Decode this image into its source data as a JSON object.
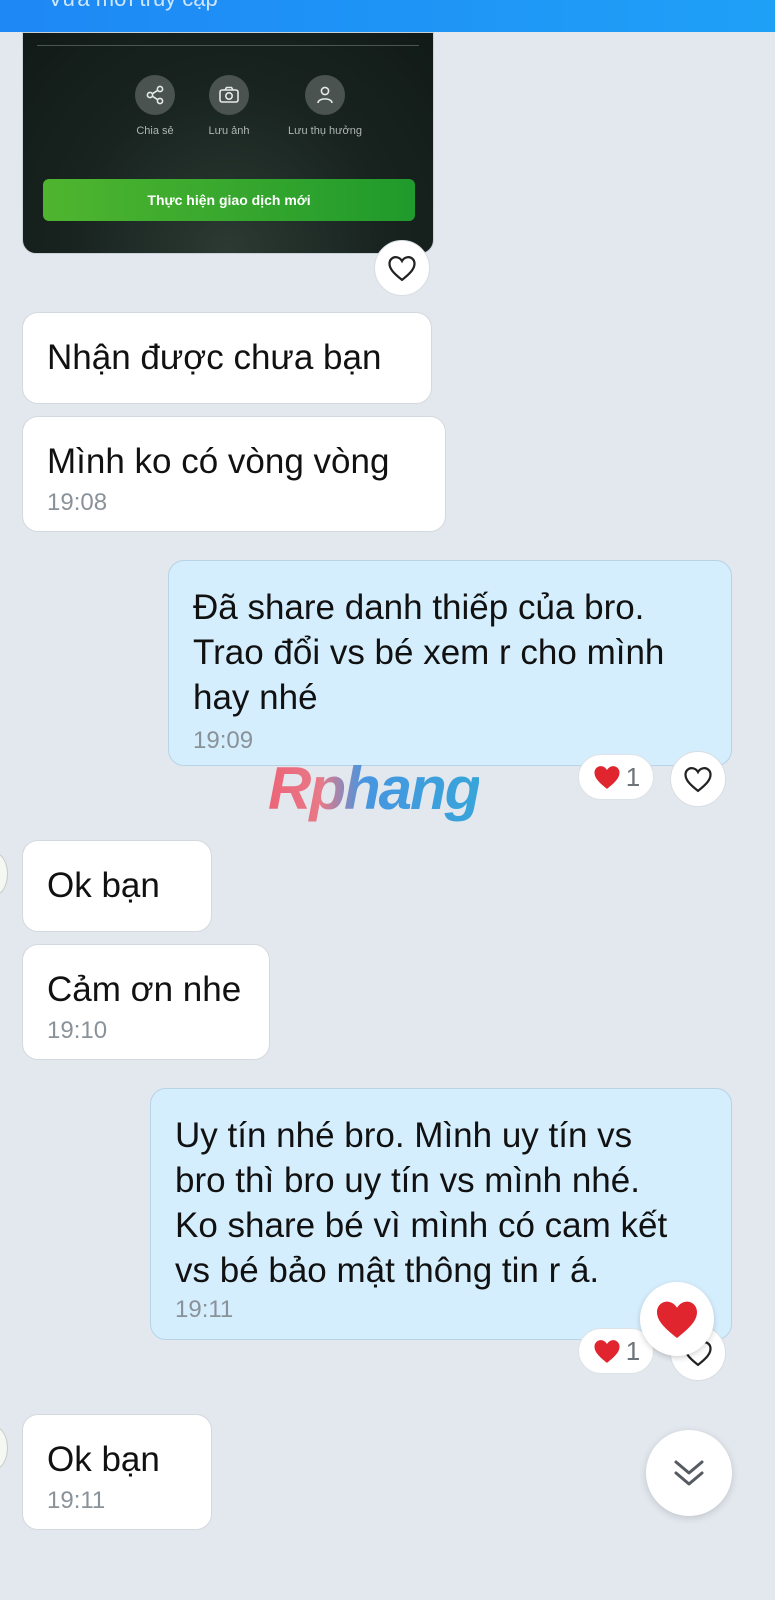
{
  "status_bar": {
    "text": "Vừa mới truy cập"
  },
  "image_card": {
    "actions": [
      {
        "label": "Chia sẻ",
        "icon": "share-icon"
      },
      {
        "label": "Lưu ảnh",
        "icon": "camera-icon"
      },
      {
        "label": "Lưu thụ hưởng",
        "icon": "person-icon"
      }
    ],
    "new_transaction_label": "Thực hiện giao dịch mới"
  },
  "messages": [
    {
      "id": "m1",
      "direction": "incoming",
      "text": "Nhận được chưa bạn",
      "time": ""
    },
    {
      "id": "m2",
      "direction": "incoming",
      "text": "Mình ko có vòng vòng",
      "time": "19:08"
    },
    {
      "id": "m3",
      "direction": "outgoing",
      "text": "Đã share danh thiếp của bro.\nTrao đổi vs bé xem r cho mình\nhay nhé",
      "time": "19:09",
      "reaction_count": "1"
    },
    {
      "id": "m4",
      "direction": "incoming",
      "text": "Ok bạn",
      "time": ""
    },
    {
      "id": "m5",
      "direction": "incoming",
      "text": "Cảm ơn nhe",
      "time": "19:10"
    },
    {
      "id": "m6",
      "direction": "outgoing",
      "text": "Uy tín nhé bro. Mình uy tín vs\nbro thì bro uy tín vs mình nhé.\nKo share bé vì mình có cam kết\nvs bé bảo mật thông tin r á.",
      "time": "19:11",
      "reaction_count": "1"
    },
    {
      "id": "m7",
      "direction": "incoming",
      "text": "Ok bạn",
      "time": "19:11"
    }
  ],
  "watermark": {
    "text": "Rphang"
  },
  "colors": {
    "background": "#e2e8ee",
    "incoming_bubble": "#ffffff",
    "outgoing_bubble": "#d5eefd",
    "heart": "#e0252f",
    "button_green": "#3aa82d",
    "top_bar": "#1e88f5"
  }
}
